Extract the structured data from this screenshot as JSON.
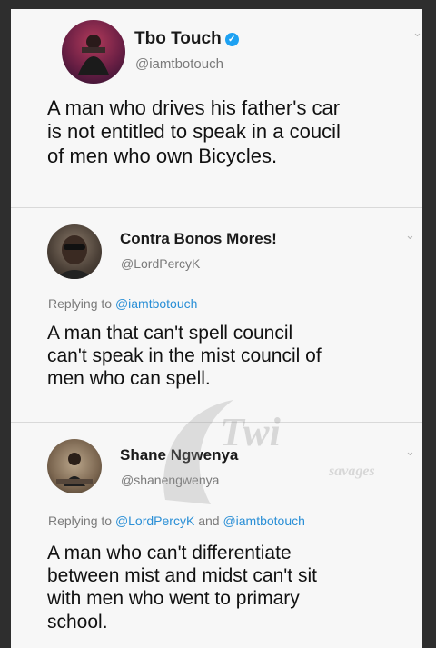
{
  "tweets": [
    {
      "name": "Tbo Touch",
      "handle": "@iamtbotouch",
      "verified": true,
      "reply_prefix": "",
      "reply_mentions": [],
      "text_lines": [
        "A man who drives his father's car",
        "is not entitled to speak in a coucil",
        "of men who own Bicycles."
      ]
    },
    {
      "name": "Contra Bonos Mores!",
      "handle": "@LordPercyK",
      "verified": false,
      "reply_prefix": "Replying to",
      "reply_mentions": [
        "@iamtbotouch"
      ],
      "text_lines": [
        "A man that can't spell council",
        "can't speak in the mist council of",
        "men who can spell."
      ]
    },
    {
      "name": "Shane Ngwenya",
      "handle": "@shanengwenya",
      "verified": false,
      "reply_prefix": "Replying to",
      "reply_mentions": [
        "@LordPercyK",
        "and",
        "@iamtbotouch"
      ],
      "text_lines": [
        "A man who can't differentiate",
        "between mist and midst can't sit",
        "with men who went to primary",
        "school."
      ]
    }
  ],
  "watermark": {
    "line1": "Twi",
    "line2": "savages"
  },
  "icons": {
    "verified": "verified-badge-icon",
    "menu": "chevron-down-icon"
  },
  "colors": {
    "mention": "#2a8fd6",
    "verified": "#1da1f2"
  }
}
